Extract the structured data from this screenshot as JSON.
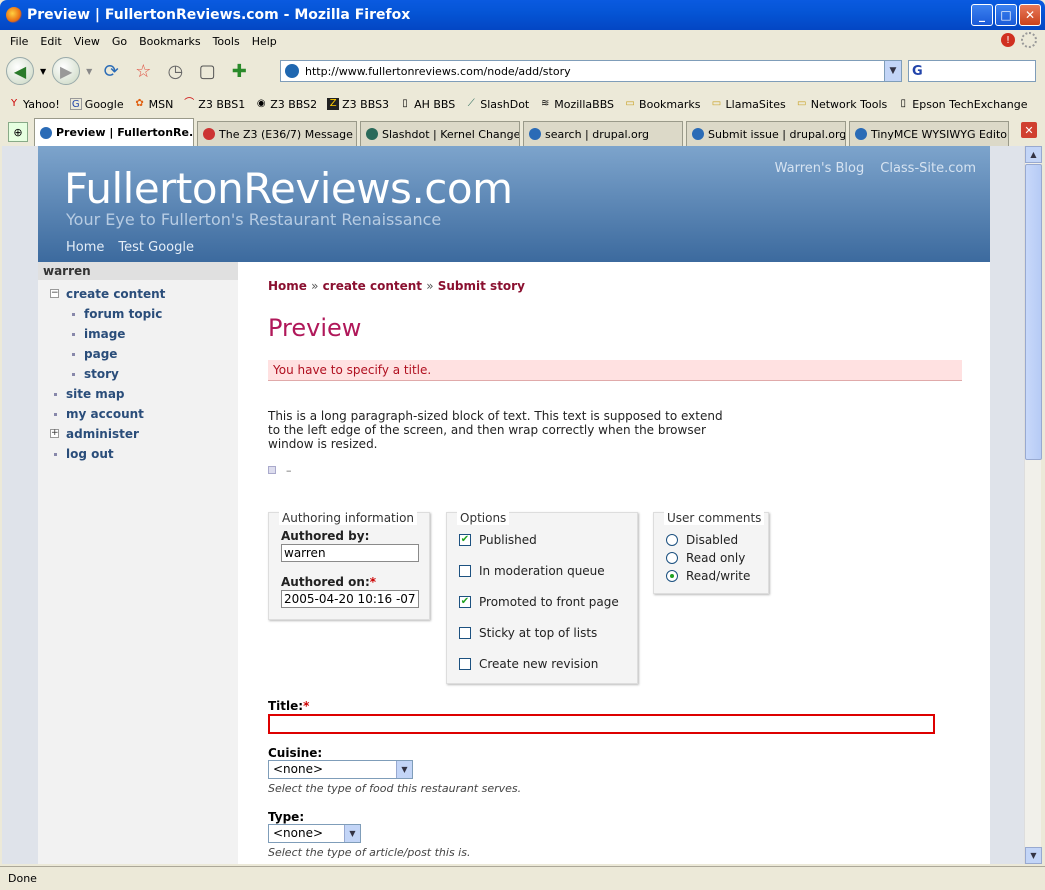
{
  "window": {
    "title": "Preview | FullertonReviews.com - Mozilla Firefox",
    "min": "_",
    "max": "□",
    "close": "✕"
  },
  "menubar": [
    "File",
    "Edit",
    "View",
    "Go",
    "Bookmarks",
    "Tools",
    "Help"
  ],
  "address": {
    "url": "http://www.fullertonreviews.com/node/add/story"
  },
  "search": {
    "engine_glyph": "G"
  },
  "bookmarks": [
    "Yahoo!",
    "Google",
    "MSN",
    "Z3 BBS1",
    "Z3 BBS2",
    "Z3 BBS3",
    "AH BBS",
    "SlashDot",
    "MozillaBBS",
    "Bookmarks",
    "LlamaSites",
    "Network Tools",
    "Epson TechExchange"
  ],
  "tabs": [
    {
      "label": "Preview | FullertonRe...",
      "active": true
    },
    {
      "label": "The Z3 (E36/7) Message ...",
      "active": false
    },
    {
      "label": "Slashdot | Kernel Change...",
      "active": false
    },
    {
      "label": "search | drupal.org",
      "active": false
    },
    {
      "label": "Submit issue | drupal.org",
      "active": false
    },
    {
      "label": "TinyMCE WYSIWYG Editor...",
      "active": false
    }
  ],
  "site": {
    "logo": "FullertonReviews.com",
    "slogan": "Your Eye to Fullerton's Restaurant Renaissance",
    "top_links": [
      "Warren's Blog",
      "Class-Site.com"
    ],
    "primary_links": [
      "Home",
      "Test Google"
    ]
  },
  "sidebar": {
    "user": "warren",
    "create_content": "create content",
    "sub_items": [
      "forum topic",
      "image",
      "page",
      "story"
    ],
    "items_after": [
      "site map",
      "my account"
    ],
    "administer": "administer",
    "logout": "log out"
  },
  "breadcrumb": {
    "home": "Home",
    "create": "create content",
    "submit": "Submit story",
    "sep": "»"
  },
  "page": {
    "title": "Preview",
    "error": "You have to specify a title.",
    "body": "This is a long paragraph-sized block of text. This text is supposed to extend to the left edge of the screen, and then wrap correctly when the browser window is resized.",
    "dash": "–"
  },
  "authoring": {
    "legend": "Authoring information",
    "by_label": "Authored by:",
    "by_value": "warren",
    "on_label": "Authored on:",
    "on_value": "2005-04-20 10:16 -07"
  },
  "options": {
    "legend": "Options",
    "items": [
      {
        "label": "Published",
        "checked": true
      },
      {
        "label": "In moderation queue",
        "checked": false
      },
      {
        "label": "Promoted to front page",
        "checked": true
      },
      {
        "label": "Sticky at top of lists",
        "checked": false
      },
      {
        "label": "Create new revision",
        "checked": false
      }
    ]
  },
  "comments": {
    "legend": "User comments",
    "items": [
      {
        "label": "Disabled",
        "selected": false
      },
      {
        "label": "Read only",
        "selected": false
      },
      {
        "label": "Read/write",
        "selected": true
      }
    ]
  },
  "form": {
    "title_label": "Title:",
    "required_mark": "*",
    "cuisine_label": "Cuisine:",
    "cuisine_value": "<none>",
    "cuisine_desc": "Select the type of food this restaurant serves.",
    "type_label": "Type:",
    "type_value": "<none>",
    "type_desc": "Select the type of article/post this is."
  },
  "status": {
    "text": "Done"
  }
}
